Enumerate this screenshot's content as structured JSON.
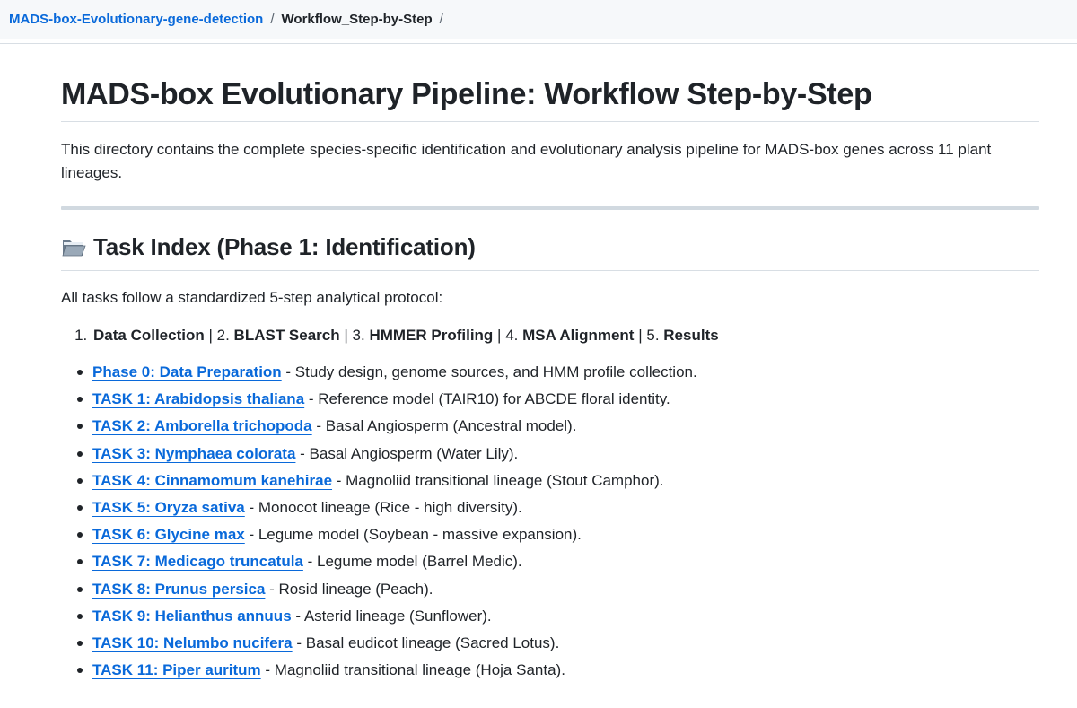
{
  "breadcrumb": {
    "repo": "MADS-box-Evolutionary-gene-detection",
    "separator": "/",
    "current": "Workflow_Step-by-Step",
    "trailing_separator": "/"
  },
  "page": {
    "title": "MADS-box Evolutionary Pipeline: Workflow Step-by-Step",
    "intro": "This directory contains the complete species-specific identification and evolutionary analysis pipeline for MADS-box genes across 11 plant lineages."
  },
  "task_index": {
    "icon": "open-folder-icon",
    "heading": "Task Index (Phase 1: Identification)",
    "protocol_intro": "All tasks follow a standardized 5-step analytical protocol:",
    "steps": [
      {
        "num": "1.",
        "label": "Data Collection"
      },
      {
        "num": "2.",
        "label": "BLAST Search"
      },
      {
        "num": "3.",
        "label": "HMMER Profiling"
      },
      {
        "num": "4.",
        "label": "MSA Alignment"
      },
      {
        "num": "5.",
        "label": "Results"
      }
    ],
    "step_separator": " | ",
    "tasks": [
      {
        "link": "Phase 0: Data Preparation",
        "desc": " - Study design, genome sources, and HMM profile collection."
      },
      {
        "link": "TASK 1: Arabidopsis thaliana",
        "desc": " - Reference model (TAIR10) for ABCDE floral identity."
      },
      {
        "link": "TASK 2: Amborella trichopoda",
        "desc": " - Basal Angiosperm (Ancestral model)."
      },
      {
        "link": "TASK 3: Nymphaea colorata",
        "desc": " - Basal Angiosperm (Water Lily)."
      },
      {
        "link": "TASK 4: Cinnamomum kanehirae",
        "desc": " - Magnoliid transitional lineage (Stout Camphor)."
      },
      {
        "link": "TASK 5: Oryza sativa",
        "desc": " - Monocot lineage (Rice - high diversity)."
      },
      {
        "link": "TASK 6: Glycine max",
        "desc": " - Legume model (Soybean - massive expansion)."
      },
      {
        "link": "TASK 7: Medicago truncatula",
        "desc": " - Legume model (Barrel Medic)."
      },
      {
        "link": "TASK 8: Prunus persica",
        "desc": " - Rosid lineage (Peach)."
      },
      {
        "link": "TASK 9: Helianthus annuus",
        "desc": " - Asterid lineage (Sunflower)."
      },
      {
        "link": "TASK 10: Nelumbo nucifera",
        "desc": " - Basal eudicot lineage (Sacred Lotus)."
      },
      {
        "link": "TASK 11: Piper auritum",
        "desc": " - Magnoliid transitional lineage (Hoja Santa)."
      }
    ]
  },
  "colors": {
    "link": "#0969da",
    "text": "#1f2328",
    "breadcrumb_bg": "#f6f8fa",
    "rule": "#d1d9e0"
  }
}
